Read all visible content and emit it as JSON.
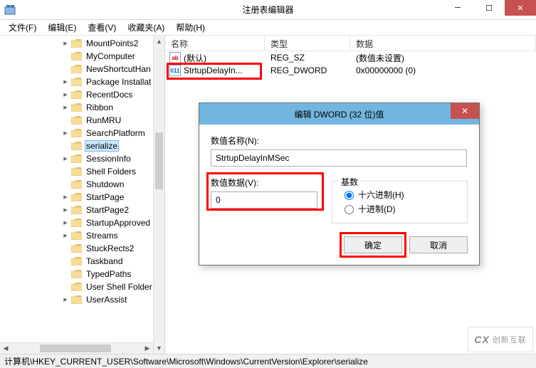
{
  "window": {
    "title": "注册表编辑器"
  },
  "menus": {
    "file": "文件(F)",
    "edit": "编辑(E)",
    "view": "查看(V)",
    "fav": "收藏夹(A)",
    "help": "帮助(H)"
  },
  "tree": {
    "items": [
      {
        "indent": 86,
        "label": "MountPoints2",
        "exp": "▸"
      },
      {
        "indent": 86,
        "label": "MyComputer",
        "exp": ""
      },
      {
        "indent": 86,
        "label": "NewShortcutHan",
        "exp": ""
      },
      {
        "indent": 86,
        "label": "Package Installat",
        "exp": "▸"
      },
      {
        "indent": 86,
        "label": "RecentDocs",
        "exp": "▸"
      },
      {
        "indent": 86,
        "label": "Ribbon",
        "exp": "▸"
      },
      {
        "indent": 86,
        "label": "RunMRU",
        "exp": ""
      },
      {
        "indent": 86,
        "label": "SearchPlatform",
        "exp": "▸"
      },
      {
        "indent": 86,
        "label": "serialize",
        "exp": "",
        "selected": true
      },
      {
        "indent": 86,
        "label": "SessionInfo",
        "exp": "▸"
      },
      {
        "indent": 86,
        "label": "Shell Folders",
        "exp": ""
      },
      {
        "indent": 86,
        "label": "Shutdown",
        "exp": ""
      },
      {
        "indent": 86,
        "label": "StartPage",
        "exp": "▸"
      },
      {
        "indent": 86,
        "label": "StartPage2",
        "exp": "▸"
      },
      {
        "indent": 86,
        "label": "StartupApproved",
        "exp": "▸"
      },
      {
        "indent": 86,
        "label": "Streams",
        "exp": "▸"
      },
      {
        "indent": 86,
        "label": "StuckRects2",
        "exp": ""
      },
      {
        "indent": 86,
        "label": "Taskband",
        "exp": ""
      },
      {
        "indent": 86,
        "label": "TypedPaths",
        "exp": ""
      },
      {
        "indent": 86,
        "label": "User Shell Folder",
        "exp": ""
      },
      {
        "indent": 86,
        "label": "UserAssist",
        "exp": "▸"
      }
    ]
  },
  "list": {
    "headers": {
      "name": "名称",
      "type": "类型",
      "data": "数据"
    },
    "rows": [
      {
        "icon": "sz",
        "iconText": "ab",
        "name": "(默认)",
        "type": "REG_SZ",
        "data": "(数值未设置)"
      },
      {
        "icon": "dw",
        "iconText": "011",
        "name": "StrtupDelayIn...",
        "type": "REG_DWORD",
        "data": "0x00000000 (0)"
      }
    ]
  },
  "dialog": {
    "title": "编辑 DWORD (32 位)值",
    "name_label": "数值名称(N):",
    "name_value": "StrtupDelayInMSec",
    "data_label": "数值数据(V):",
    "data_value": "0",
    "base_legend": "基数",
    "radio_hex": "十六进制(H)",
    "radio_dec": "十进制(D)",
    "ok": "确定",
    "cancel": "取消"
  },
  "status": {
    "path": "计算机\\HKEY_CURRENT_USER\\Software\\Microsoft\\Windows\\CurrentVersion\\Explorer\\serialize"
  },
  "watermark": {
    "logo": "CX",
    "text": "创新互联"
  }
}
